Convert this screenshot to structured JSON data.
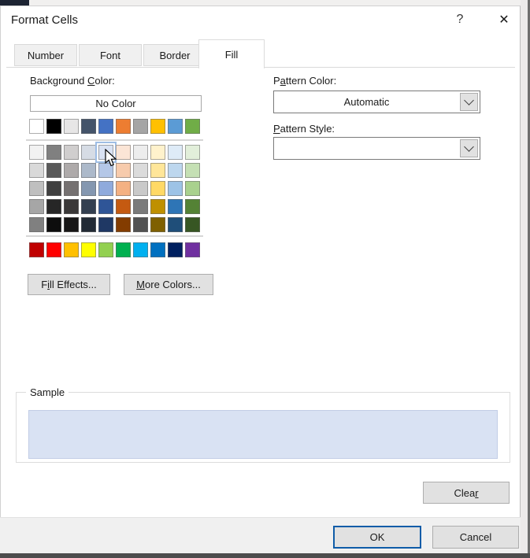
{
  "window": {
    "title": "Format Cells",
    "help": "?",
    "close": "✕"
  },
  "tabs": [
    {
      "label": "Number"
    },
    {
      "label": "Font"
    },
    {
      "label": "Border"
    },
    {
      "label": "Fill"
    }
  ],
  "active_tab": "Fill",
  "background": {
    "label": {
      "pre": "Background ",
      "accel": "C",
      "post": "olor:"
    },
    "no_color_label": "No Color",
    "theme_colors": [
      "#FFFFFF",
      "#000000",
      "#E7E6E6",
      "#44546A",
      "#4472C4",
      "#ED7D31",
      "#A5A5A5",
      "#FFC000",
      "#5B9BD5",
      "#70AD47"
    ],
    "variant_rows": [
      [
        "#F2F2F2",
        "#808080",
        "#D0CECE",
        "#D6DCE5",
        "#D9E2F3",
        "#FBE5D6",
        "#EDEDED",
        "#FFF2CC",
        "#DEEBF7",
        "#E2EFDA"
      ],
      [
        "#D9D9D9",
        "#595959",
        "#AEAAAA",
        "#ACB9CA",
        "#B4C7E7",
        "#F7CBAC",
        "#DBDBDB",
        "#FFE699",
        "#BDD7EE",
        "#C5E0B4"
      ],
      [
        "#BFBFBF",
        "#404040",
        "#757171",
        "#8497B0",
        "#8FAADC",
        "#F4B183",
        "#C9C9C9",
        "#FFD966",
        "#9DC3E6",
        "#A9D18E"
      ],
      [
        "#A6A6A6",
        "#262626",
        "#3A3838",
        "#333F50",
        "#2F5597",
        "#C55A11",
        "#7B7B7B",
        "#BF9000",
        "#2E75B6",
        "#548235"
      ],
      [
        "#808080",
        "#0D0D0D",
        "#171616",
        "#222A35",
        "#1F3864",
        "#833C00",
        "#525252",
        "#7F6000",
        "#1F4E79",
        "#375623"
      ]
    ],
    "standard_colors": [
      "#C00000",
      "#FF0000",
      "#FFC000",
      "#FFFF00",
      "#92D050",
      "#00B050",
      "#00B0F0",
      "#0070C0",
      "#002060",
      "#7030A0"
    ],
    "hovered": {
      "row": 0,
      "col": 4,
      "color": "#D9E2F3"
    }
  },
  "pattern_color": {
    "label": {
      "pre": "P",
      "accel": "a",
      "post": "ttern Color:"
    },
    "value": "Automatic"
  },
  "pattern_style": {
    "label": {
      "pre": "",
      "accel": "P",
      "post": "attern Style:"
    },
    "value": ""
  },
  "buttons": {
    "fill_effects": {
      "pre": "F",
      "accel": "i",
      "post": "ll Effects..."
    },
    "more_colors": {
      "pre": "",
      "accel": "M",
      "post": "ore Colors..."
    },
    "clear": {
      "pre": "Clea",
      "accel": "r",
      "post": ""
    },
    "ok": "OK",
    "cancel": "Cancel"
  },
  "sample": {
    "label": "Sample",
    "fill_color": "#D9E2F3"
  }
}
